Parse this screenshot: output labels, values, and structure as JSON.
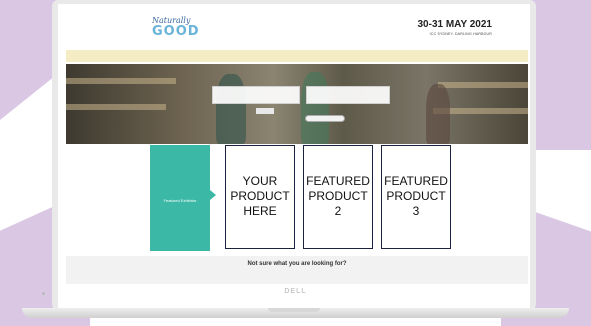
{
  "header": {
    "logo_script": "Naturally",
    "logo_word": "GOOD",
    "event_date": "30-31 MAY 2021",
    "event_venue": "ICC SYDNEY, DARLING HARBOUR"
  },
  "notice": {
    "text": ""
  },
  "hero": {
    "field_1_label": "",
    "field_2_label": "",
    "find_button_label": ""
  },
  "featured": {
    "exhibitor_label": "Featured Exhibitor",
    "products": [
      {
        "line1": "YOUR",
        "line2": "PRODUCT",
        "line3": "HERE"
      },
      {
        "line1": "FEATURED",
        "line2": "PRODUCT",
        "line3": "2"
      },
      {
        "line1": "FEATURED",
        "line2": "PRODUCT",
        "line3": "3"
      }
    ]
  },
  "help": {
    "title": "Not sure what you are looking for?",
    "subtitle": "",
    "link": ""
  },
  "laptop": {
    "brand": "DELL"
  },
  "colors": {
    "teal": "#3bb8a6",
    "navy": "#1c2140",
    "decor_purple": "#d9c7e3",
    "notice_yellow": "#f4ecc4"
  }
}
